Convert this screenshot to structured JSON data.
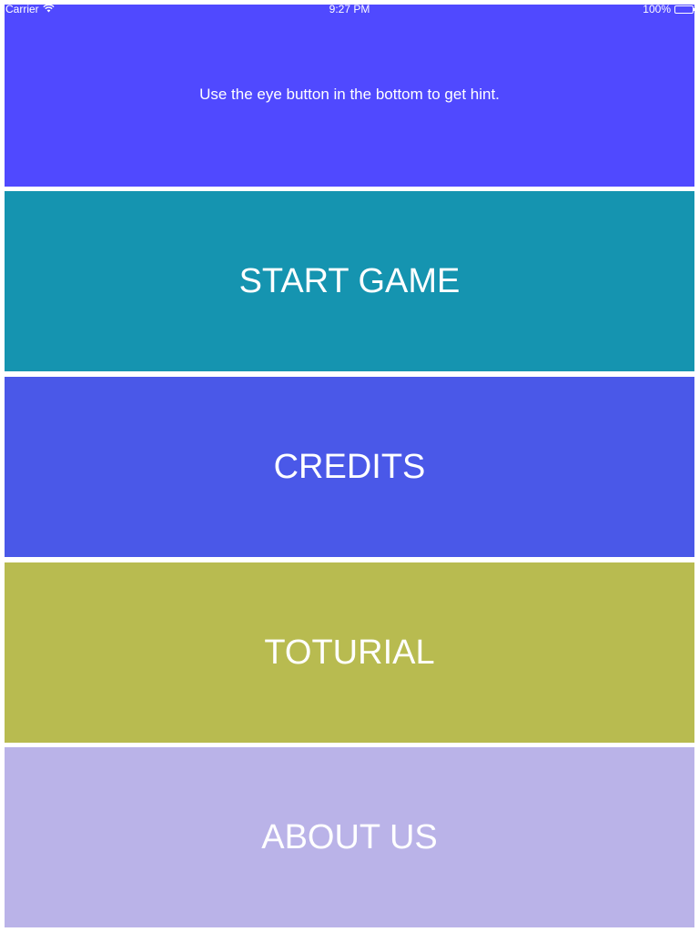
{
  "status_bar": {
    "carrier": "Carrier",
    "time": "9:27 PM",
    "battery": "100%",
    "battery_level": 1.0,
    "icons": [
      "wifi-icon",
      "battery-icon"
    ]
  },
  "hint": {
    "text": "Use the eye button in the bottom to get hint."
  },
  "menu": {
    "start_label": "START GAME",
    "credits_label": "CREDITS",
    "tutorial_label": "TOTURIAL",
    "about_label": "ABOUT US"
  },
  "colors": {
    "hint_bg": "#5049ff",
    "start_bg": "#1594b0",
    "credits_bg": "#4a58e8",
    "tutorial_bg": "#b8bb50",
    "about_bg": "#bab3e8",
    "text": "#ffffff"
  }
}
